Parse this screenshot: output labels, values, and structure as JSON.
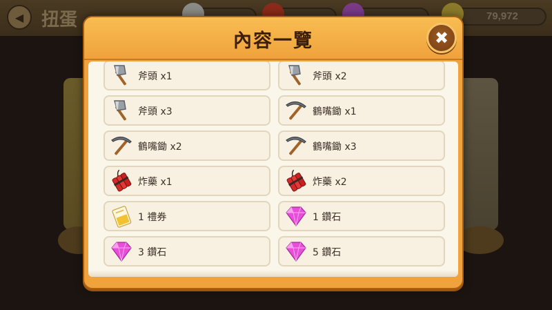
{
  "background": {
    "screen_title": "扭蛋",
    "coin_amount": "79,972"
  },
  "modal": {
    "title": "內容一覽",
    "close_symbol": "✖"
  },
  "items": [
    [
      {
        "icon": "axe-icon",
        "label": "斧頭 x1"
      },
      {
        "icon": "axe-icon",
        "label": "斧頭 x2"
      }
    ],
    [
      {
        "icon": "axe-icon",
        "label": "斧頭 x3"
      },
      {
        "icon": "pickaxe-icon",
        "label": "鶴嘴鋤 x1"
      }
    ],
    [
      {
        "icon": "pickaxe-icon",
        "label": "鶴嘴鋤 x2"
      },
      {
        "icon": "pickaxe-icon",
        "label": "鶴嘴鋤 x3"
      }
    ],
    [
      {
        "icon": "dynamite-icon",
        "label": "炸藥 x1"
      },
      {
        "icon": "dynamite-icon",
        "label": "炸藥 x2"
      }
    ],
    [
      {
        "icon": "ticket-icon",
        "label": "1 禮券"
      },
      {
        "icon": "diamond-icon",
        "label": "1 鑽石"
      }
    ],
    [
      {
        "icon": "diamond-icon",
        "label": "3 鑽石"
      },
      {
        "icon": "diamond-icon",
        "label": "5 鑽石"
      }
    ]
  ],
  "colors": {
    "modal_orange": "#f0a23c",
    "title_brown": "#3c1d08",
    "card_bg": "#f8f1e2",
    "diamond_pink": "#e84fd8",
    "dynamite_red": "#d42a2a"
  }
}
